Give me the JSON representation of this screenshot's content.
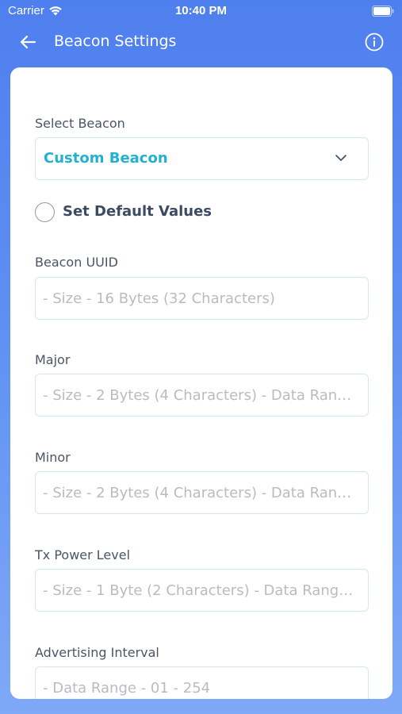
{
  "status_bar": {
    "carrier": "Carrier",
    "time": "10:40 PM"
  },
  "nav": {
    "title": "Beacon Settings",
    "back_icon": "arrow-left-icon",
    "info_icon": "info-circle-icon"
  },
  "form": {
    "select_beacon": {
      "label": "Select Beacon",
      "value": "Custom Beacon"
    },
    "default_values": {
      "label": "Set Default Values",
      "checked": false
    },
    "uuid": {
      "label": "Beacon UUID",
      "placeholder": "- Size - 16 Bytes (32 Characters)"
    },
    "major": {
      "label": "Major",
      "placeholder": "- Size - 2 Bytes (4 Characters) - Data Ran…"
    },
    "minor": {
      "label": "Minor",
      "placeholder": "- Size - 2 Bytes (4 Characters) - Data Ran…"
    },
    "tx_power": {
      "label": "Tx Power Level",
      "placeholder": "- Size - 1 Byte (2 Characters) - Data Rang…"
    },
    "adv_interval": {
      "label": "Advertising Interval",
      "placeholder": "- Data Range - 01 - 254"
    }
  },
  "colors": {
    "header_bg": "#4e7fee",
    "accent": "#22b2cf",
    "field_border": "#d3e6f6"
  }
}
